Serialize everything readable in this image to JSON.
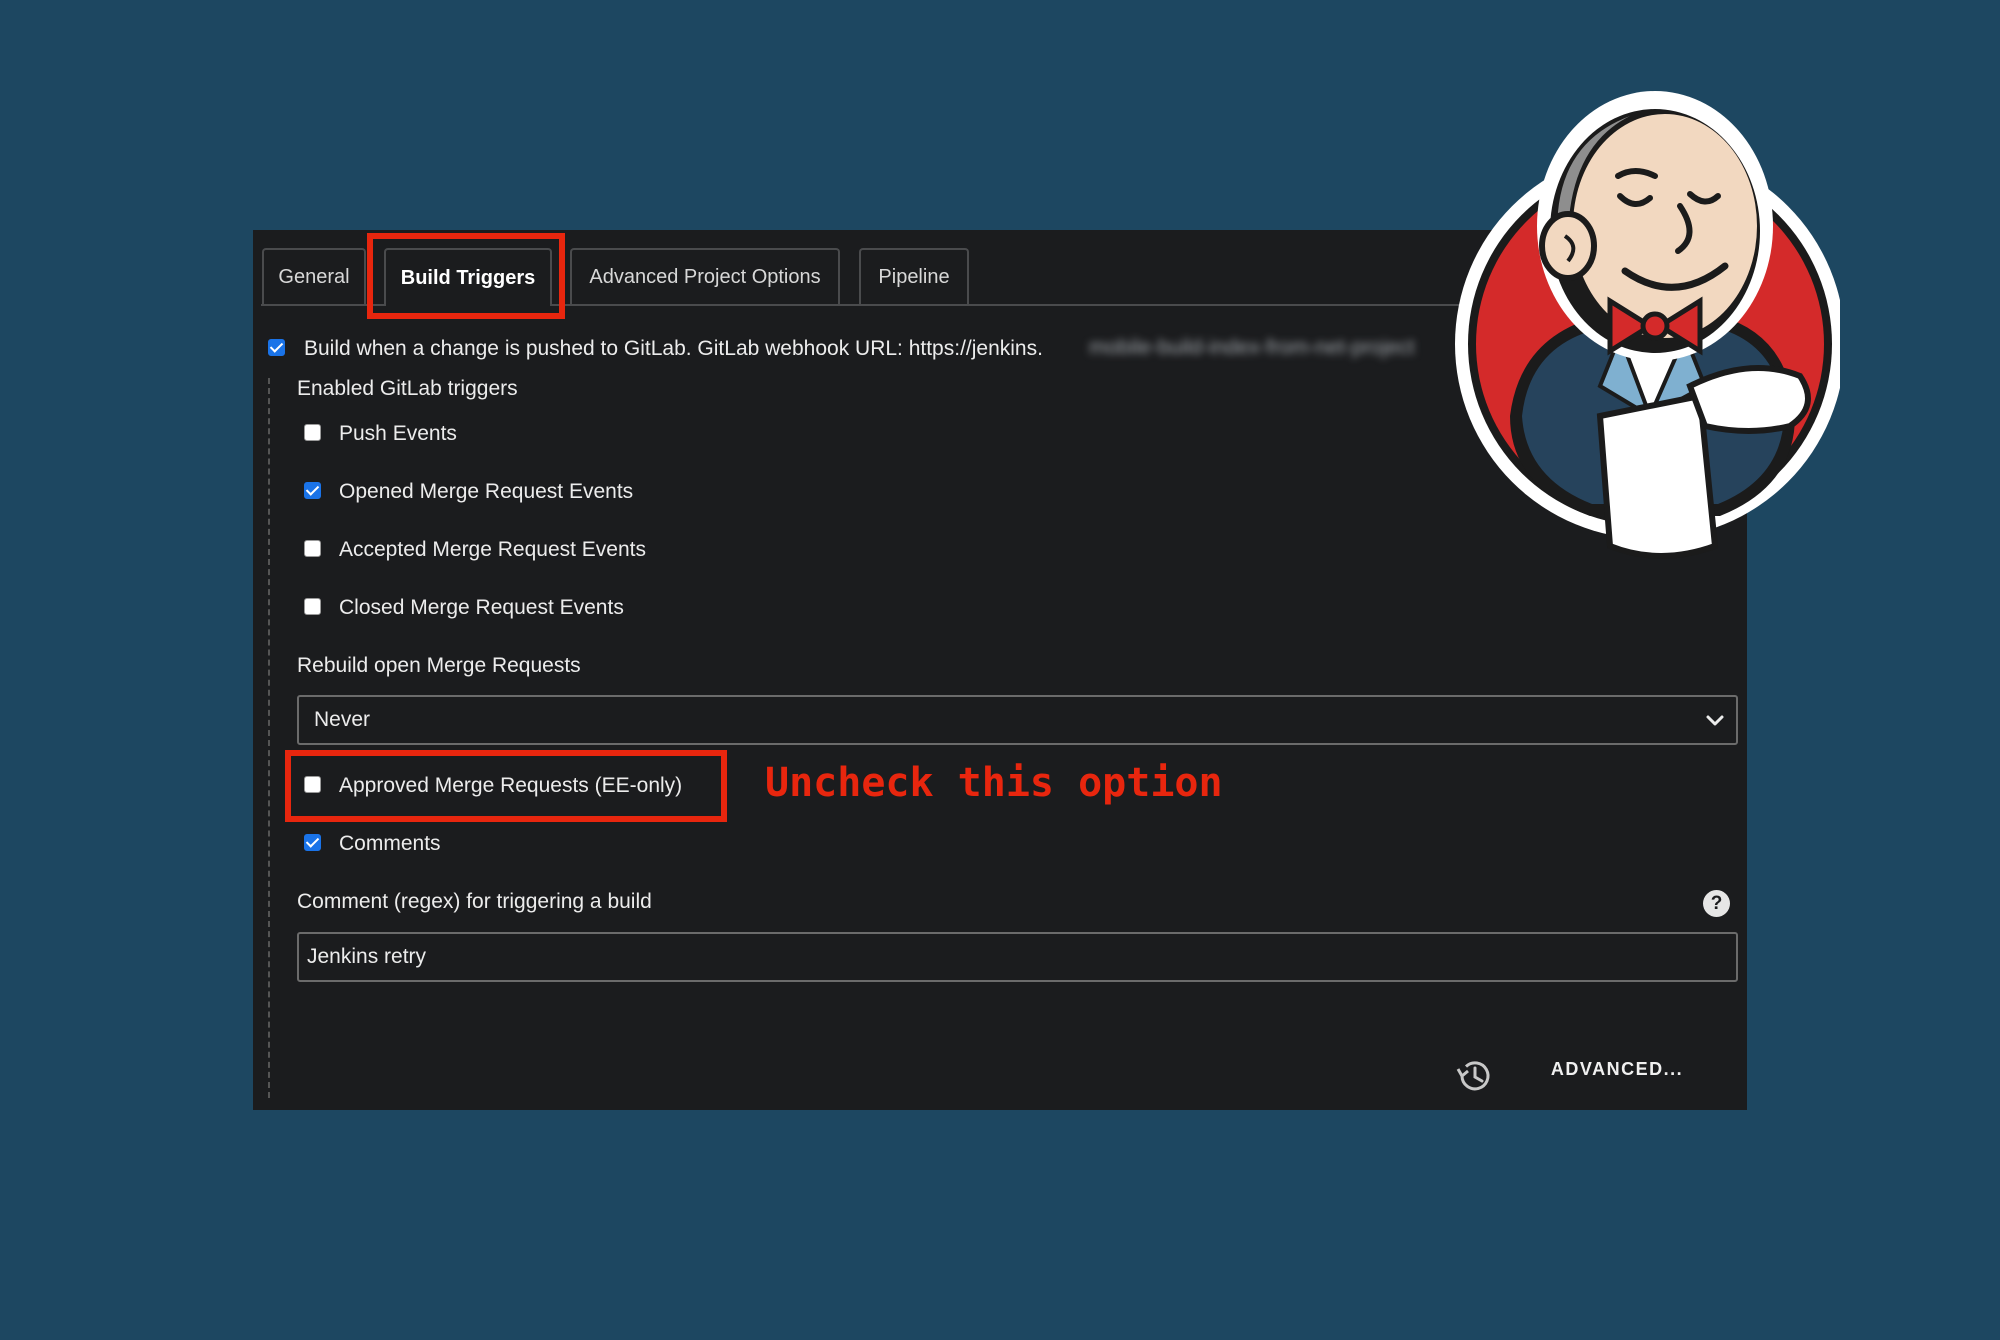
{
  "tabs": [
    {
      "label": "General"
    },
    {
      "label": "Build Triggers",
      "active": true
    },
    {
      "label": "Advanced Project Options"
    },
    {
      "label": "Pipeline"
    }
  ],
  "gitlab": {
    "checked": true,
    "label": "Build when a change is pushed to GitLab. GitLab webhook URL: https://jenkins.",
    "url_blurred": "mobile-build-index-from-net-project"
  },
  "triggers_heading": "Enabled GitLab triggers",
  "triggers": [
    {
      "label": "Push Events",
      "checked": false
    },
    {
      "label": "Opened Merge Request Events",
      "checked": true
    },
    {
      "label": "Accepted Merge Request Events",
      "checked": false
    },
    {
      "label": "Closed Merge Request Events",
      "checked": false
    }
  ],
  "rebuild": {
    "label": "Rebuild open Merge Requests",
    "value": "Never"
  },
  "approved": {
    "label": "Approved Merge Requests (EE-only)",
    "checked": false
  },
  "annotation": "Uncheck this option",
  "comments": {
    "label": "Comments",
    "checked": true
  },
  "comment_regex": {
    "label": "Comment (regex) for triggering a build",
    "value": "Jenkins retry",
    "help": "?"
  },
  "advanced_button": "ADVANCED...",
  "colors": {
    "background": "#1d4761",
    "panel": "#1b1c1e",
    "highlight": "#e8260e",
    "checkbox": "#1a73e8"
  },
  "icons": [
    "checkbox-checked-icon",
    "checkbox-unchecked-icon",
    "chevron-down-icon",
    "help-icon",
    "history-icon",
    "jenkins-mascot-logo"
  ]
}
